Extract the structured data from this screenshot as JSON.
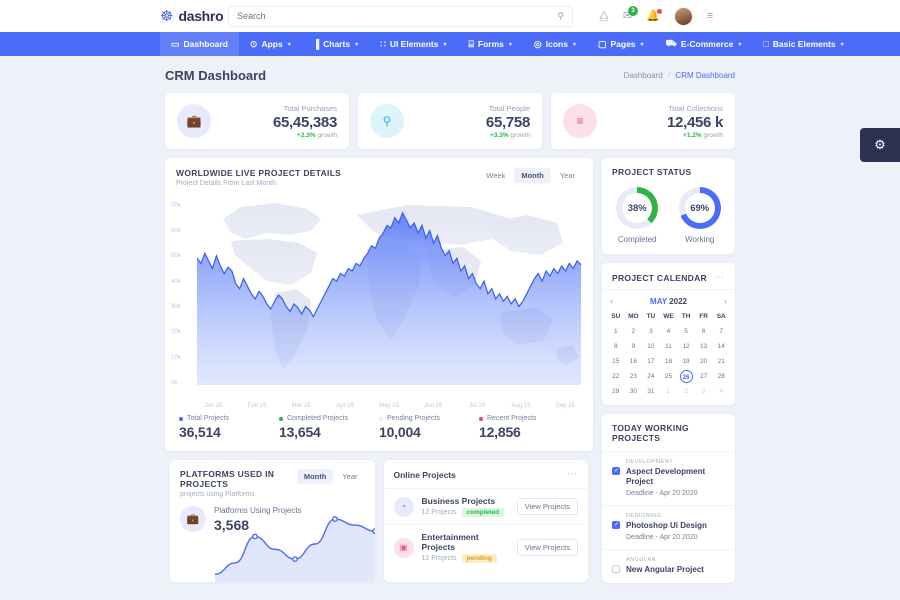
{
  "topbar": {
    "brand": "dashro",
    "brand_icon": "swirl-logo-icon",
    "search_placeholder": "Search",
    "search_value": "",
    "search_icon": "search-icon",
    "expand_icon": "expand-icon",
    "mail_icon": "mail-icon",
    "mail_badge": "3",
    "bell_icon": "bell-icon",
    "avatar": "user-avatar",
    "settings_icon": "sliders-icon"
  },
  "nav": [
    {
      "label": "Dashboard",
      "icon": "monitor-icon",
      "caret": false,
      "active": true
    },
    {
      "label": "Apps",
      "icon": "apps-icon",
      "caret": true,
      "active": false
    },
    {
      "label": "Charts",
      "icon": "bar-chart-icon",
      "caret": true,
      "active": false
    },
    {
      "label": "UI Elements",
      "icon": "grid-icon",
      "caret": true,
      "active": false
    },
    {
      "label": "Forms",
      "icon": "file-icon",
      "caret": true,
      "active": false
    },
    {
      "label": "Icons",
      "icon": "circle-target-icon",
      "caret": true,
      "active": false
    },
    {
      "label": "Pages",
      "icon": "window-icon",
      "caret": true,
      "active": false
    },
    {
      "label": "E-Commerce",
      "icon": "cart-icon",
      "caret": true,
      "active": false
    },
    {
      "label": "Basic Elements",
      "icon": "bag-icon",
      "caret": true,
      "active": false
    }
  ],
  "page": {
    "title": "CRM Dashboard",
    "breadcrumb_root": "Dashboard",
    "breadcrumb_sep": "/",
    "breadcrumb_current": "CRM Dashboard"
  },
  "stats": [
    {
      "label": "Total Purchases",
      "value": "65,45,383",
      "growth": "+2.3%",
      "growth_suffix": "growth",
      "icon": "briefcase-icon",
      "icon_bg": "#e6eafc",
      "icon_color": "#4a6cf7"
    },
    {
      "label": "Total People",
      "value": "65,758",
      "growth": "+3.3%",
      "growth_suffix": "growth",
      "icon": "user-icon",
      "icon_bg": "#dff3fb",
      "icon_color": "#3ab0d8"
    },
    {
      "label": "Total Collections",
      "value": "12,456 k",
      "growth": "+1.2%",
      "growth_suffix": "growth",
      "icon": "layers-icon",
      "icon_bg": "#fbe0e8",
      "icon_color": "#ef4d7a"
    }
  ],
  "worldwide": {
    "title": "WORLDWIDE LIVE PROJECT DETAILS",
    "subtitle": "Project Details From Last Month.",
    "ranges": [
      {
        "label": "Week",
        "active": false
      },
      {
        "label": "Month",
        "active": true
      },
      {
        "label": "Year",
        "active": false
      }
    ],
    "legend": [
      {
        "name": "Total Projects",
        "value": "36,514",
        "color": "#4a6cf7"
      },
      {
        "name": "Completed Projects",
        "value": "13,654",
        "color": "#2fb344"
      },
      {
        "name": "Pending Projects",
        "value": "10,004",
        "color": "#e8eaf2"
      },
      {
        "name": "Recent Projects",
        "value": "12,856",
        "color": "#f2416b"
      }
    ]
  },
  "chart_data": {
    "type": "area",
    "title": "WORLDWIDE LIVE PROJECT DETAILS",
    "subtitle": "Project Details From Last Month.",
    "xlabel": "",
    "ylabel": "",
    "ylim": [
      0,
      75000
    ],
    "ytick_labels": [
      "70k",
      "60k",
      "50k",
      "40k",
      "30k",
      "20k",
      "10k",
      "0k"
    ],
    "ytick_values": [
      70000,
      60000,
      50000,
      40000,
      30000,
      20000,
      10000,
      0
    ],
    "grid": false,
    "legend_position": "below",
    "categories": [
      "Jan 19",
      "Feb 19",
      "Mar 19",
      "Apr 19",
      "May 19",
      "Jun 19",
      "Jul 19",
      "Aug 19",
      "Sep 19"
    ],
    "series": [
      {
        "name": "Total Projects",
        "color": "#4a6cf7",
        "values": [
          50000,
          48000,
          52000,
          49000,
          46000,
          51000,
          47000,
          44000,
          46500,
          45000,
          40000,
          38000,
          42000,
          39000,
          36000,
          34000,
          37000,
          35000,
          32000,
          30000,
          33000,
          35500,
          34000,
          31000,
          29000,
          32000,
          30500,
          28000,
          31000,
          29500,
          27000,
          30000,
          33000,
          36000,
          39000,
          42000,
          41000,
          44000,
          43000,
          46000,
          45000,
          48000,
          47000,
          50000,
          52000,
          55000,
          54000,
          58000,
          60000,
          63000,
          62000,
          66000,
          64000,
          68000,
          65000,
          62000,
          64000,
          60000,
          63000,
          58000,
          61000,
          56000,
          59000,
          54000,
          51000,
          53000,
          48000,
          50000,
          45000,
          47000,
          42000,
          44000,
          40000,
          38000,
          41000,
          36000,
          38000,
          34000,
          36000,
          33000,
          35000,
          32000,
          34000,
          31000,
          33000,
          36000,
          39000,
          42000,
          44000,
          41000,
          45000,
          43000,
          46000,
          44000,
          47000,
          45000,
          48000,
          46000,
          49000,
          47500
        ]
      }
    ]
  },
  "project_status": {
    "title": "PROJECT STATUS",
    "rings": [
      {
        "percent": "38%",
        "value": 38,
        "label": "Completed",
        "color": "#2fb344"
      },
      {
        "percent": "69%",
        "value": 69,
        "label": "Working",
        "color": "#4a6cf7"
      }
    ]
  },
  "calendar": {
    "title": "PROJECT CALENDAR",
    "menu_icon": "ellipsis-icon",
    "prev_icon": "chevron-left-icon",
    "next_icon": "chevron-right-icon",
    "month": "MAY",
    "year": "2022",
    "dow": [
      "SU",
      "MO",
      "TU",
      "WE",
      "TH",
      "FR",
      "SA"
    ],
    "selected_day": 26,
    "weeks": [
      [
        {
          "d": "1"
        },
        {
          "d": "2"
        },
        {
          "d": "3"
        },
        {
          "d": "4"
        },
        {
          "d": "5"
        },
        {
          "d": "6"
        },
        {
          "d": "7"
        }
      ],
      [
        {
          "d": "8"
        },
        {
          "d": "9"
        },
        {
          "d": "10"
        },
        {
          "d": "11"
        },
        {
          "d": "12"
        },
        {
          "d": "13"
        },
        {
          "d": "14"
        }
      ],
      [
        {
          "d": "15"
        },
        {
          "d": "16"
        },
        {
          "d": "17"
        },
        {
          "d": "18"
        },
        {
          "d": "19"
        },
        {
          "d": "20"
        },
        {
          "d": "21"
        }
      ],
      [
        {
          "d": "22"
        },
        {
          "d": "23"
        },
        {
          "d": "24"
        },
        {
          "d": "25"
        },
        {
          "d": "26",
          "today": true
        },
        {
          "d": "27"
        },
        {
          "d": "28"
        }
      ],
      [
        {
          "d": "29"
        },
        {
          "d": "30"
        },
        {
          "d": "31"
        },
        {
          "d": "1",
          "mute": true
        },
        {
          "d": "2",
          "mute": true
        },
        {
          "d": "3",
          "mute": true
        },
        {
          "d": "4",
          "mute": true
        }
      ]
    ]
  },
  "today_projects": {
    "title": "TODAY WORKING PROJECTS",
    "items": [
      {
        "tag": "DEVELOPMENT",
        "name": "Aspect Development Project",
        "deadline": "Deadline - Apr 20 2020",
        "checked": true
      },
      {
        "tag": "DESIGNING",
        "name": "Photoshop Ui Design",
        "deadline": "Deadline - Apr 20 2020",
        "checked": true
      },
      {
        "tag": "ANGULAR",
        "name": "New Angular Project",
        "deadline": "",
        "checked": false
      }
    ]
  },
  "platforms": {
    "title": "PLATFORMS USED IN PROJECTS",
    "subtitle": "projects using Platforms",
    "ranges": [
      {
        "label": "Month",
        "active": true
      },
      {
        "label": "Year",
        "active": false
      }
    ],
    "icon": "briefcase-icon",
    "metric_label": "Platforms Using Projects",
    "metric_value": "3,568",
    "spark_values": [
      5,
      20,
      55,
      38,
      25,
      45,
      78,
      70,
      62
    ]
  },
  "online_projects": {
    "title": "Online Projects",
    "menu_icon": "ellipsis-icon",
    "rows": [
      {
        "name": "Business Projects",
        "count": "12 Projects",
        "status": "completed",
        "status_kind": "completed",
        "action": "View Projects",
        "icon": "pie-chart-icon",
        "icon_bg": "#e6eafc",
        "icon_color": "#4a6cf7"
      },
      {
        "name": "Entertainment Projects",
        "count": "12 Projects",
        "status": "pending",
        "status_kind": "pending",
        "action": "View Projects",
        "icon": "camera-icon",
        "icon_bg": "#fbe0e8",
        "icon_color": "#ef4d7a"
      }
    ]
  },
  "fab": {
    "icon": "gear-icon"
  }
}
